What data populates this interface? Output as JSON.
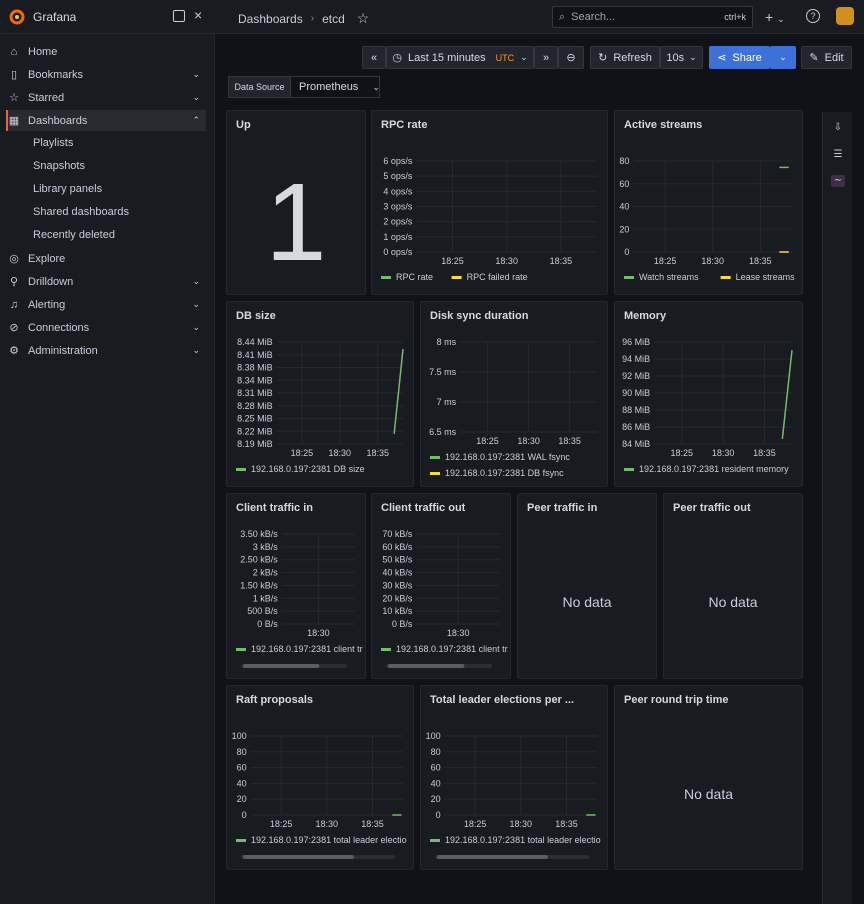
{
  "app": {
    "brand": "Grafana"
  },
  "breadcrumb": {
    "dashboards": "Dashboards",
    "current": "etcd"
  },
  "search": {
    "placeholder": "Search...",
    "shortcut": "ctrl+k"
  },
  "sidebar": {
    "items": [
      {
        "label": "Home",
        "icon": "home-icon"
      },
      {
        "label": "Bookmarks",
        "icon": "bookmark-icon"
      },
      {
        "label": "Starred",
        "icon": "star-icon"
      },
      {
        "label": "Dashboards",
        "icon": "dashboards-icon"
      },
      {
        "label": "Explore",
        "icon": "compass-icon"
      },
      {
        "label": "Drilldown",
        "icon": "drilldown-icon"
      },
      {
        "label": "Alerting",
        "icon": "bell-icon"
      },
      {
        "label": "Connections",
        "icon": "connections-icon"
      },
      {
        "label": "Administration",
        "icon": "gear-icon"
      }
    ],
    "subitems": [
      "Playlists",
      "Snapshots",
      "Library panels",
      "Shared dashboards",
      "Recently deleted"
    ]
  },
  "toolbar": {
    "time_range": "Last 15 minutes",
    "tz": "UTC",
    "refresh": "Refresh",
    "interval": "10s",
    "share": "Share",
    "edit": "Edit"
  },
  "variable": {
    "label": "Data Source",
    "value": "Prometheus"
  },
  "panels": {
    "up": {
      "title": "Up",
      "value": "1"
    },
    "rpc": {
      "title": "RPC rate"
    },
    "streams": {
      "title": "Active streams"
    },
    "db": {
      "title": "DB size"
    },
    "disk": {
      "title": "Disk sync duration"
    },
    "mem": {
      "title": "Memory"
    },
    "cin": {
      "title": "Client traffic in"
    },
    "cout": {
      "title": "Client traffic out"
    },
    "pin": {
      "title": "Peer traffic in",
      "nodata": "No data"
    },
    "pout": {
      "title": "Peer traffic out",
      "nodata": "No data"
    },
    "raft": {
      "title": "Raft proposals"
    },
    "elect": {
      "title": "Total leader elections per ..."
    },
    "rtt": {
      "title": "Peer round trip time",
      "nodata": "No data"
    }
  },
  "chart_data": [
    {
      "id": "rpc",
      "type": "line",
      "y_ticks": [
        "6 ops/s",
        "5 ops/s",
        "4 ops/s",
        "3 ops/s",
        "2 ops/s",
        "1 ops/s",
        "0 ops/s"
      ],
      "x_ticks": [
        "18:25",
        "18:30",
        "18:35"
      ],
      "legend": [
        {
          "name": "RPC rate",
          "color": "#73bf69"
        },
        {
          "name": "RPC failed rate",
          "color": "#fade2a"
        }
      ],
      "series": []
    },
    {
      "id": "streams",
      "type": "line",
      "y_ticks": [
        "80",
        "60",
        "40",
        "20",
        "0"
      ],
      "x_ticks": [
        "18:25",
        "18:30",
        "18:35"
      ],
      "legend": [
        {
          "name": "Watch streams",
          "color": "#73bf69"
        },
        {
          "name": "Lease streams",
          "color": "#fade2a"
        }
      ],
      "series": [
        {
          "name": "Watch streams",
          "color": "#73bf69",
          "segment": [
            0.92,
            0.98
          ],
          "yfrac": 0.93
        },
        {
          "name": "Lease streams",
          "color": "#fade2a",
          "segment": [
            0.92,
            0.98
          ],
          "yfrac": 0.0
        }
      ]
    },
    {
      "id": "db",
      "type": "line",
      "y_ticks": [
        "8.44 MiB",
        "8.41 MiB",
        "8.38 MiB",
        "8.34 MiB",
        "8.31 MiB",
        "8.28 MiB",
        "8.25 MiB",
        "8.22 MiB",
        "8.19 MiB"
      ],
      "x_ticks": [
        "18:25",
        "18:30",
        "18:35"
      ],
      "legend": [
        {
          "name": "192.168.0.197:2381 DB size",
          "color": "#73bf69"
        }
      ],
      "series": [
        {
          "color": "#73bf69",
          "line": [
            [
              0.93,
              0.1
            ],
            [
              1.0,
              0.93
            ]
          ]
        }
      ]
    },
    {
      "id": "disk",
      "type": "line",
      "y_ticks": [
        "8 ms",
        "7.5 ms",
        "7 ms",
        "6.5 ms"
      ],
      "x_ticks": [
        "18:25",
        "18:30",
        "18:35"
      ],
      "legend": [
        {
          "name": "192.168.0.197:2381 WAL fsync",
          "color": "#73bf69"
        },
        {
          "name": "192.168.0.197:2381 DB fsync",
          "color": "#fade2a"
        }
      ],
      "series": []
    },
    {
      "id": "mem",
      "type": "line",
      "y_ticks": [
        "96 MiB",
        "94 MiB",
        "92 MiB",
        "90 MiB",
        "88 MiB",
        "86 MiB",
        "84 MiB"
      ],
      "x_ticks": [
        "18:25",
        "18:30",
        "18:35"
      ],
      "legend": [
        {
          "name": "192.168.0.197:2381 resident memory",
          "color": "#73bf69"
        }
      ],
      "series": [
        {
          "color": "#73bf69",
          "line": [
            [
              0.93,
              0.05
            ],
            [
              1.0,
              0.92
            ]
          ]
        }
      ]
    },
    {
      "id": "cin",
      "type": "line",
      "y_ticks": [
        "3.50 kB/s",
        "3 kB/s",
        "2.50 kB/s",
        "2 kB/s",
        "1.50 kB/s",
        "1 kB/s",
        "500 B/s",
        "0 B/s"
      ],
      "x_ticks": [
        "18:30"
      ],
      "legend": [
        {
          "name": "192.168.0.197:2381 client tr",
          "color": "#73bf69"
        }
      ],
      "series": []
    },
    {
      "id": "cout",
      "type": "line",
      "y_ticks": [
        "70 kB/s",
        "60 kB/s",
        "50 kB/s",
        "40 kB/s",
        "30 kB/s",
        "20 kB/s",
        "10 kB/s",
        "0 B/s"
      ],
      "x_ticks": [
        "18:30"
      ],
      "legend": [
        {
          "name": "192.168.0.197:2381 client tr",
          "color": "#73bf69"
        }
      ],
      "series": []
    },
    {
      "id": "raft",
      "type": "line",
      "y_ticks": [
        "100",
        "80",
        "60",
        "40",
        "20",
        "0"
      ],
      "x_ticks": [
        "18:25",
        "18:30",
        "18:35"
      ],
      "legend": [
        {
          "name": "192.168.0.197:2381 total leader electio",
          "color": "#73bf69"
        }
      ],
      "series": [
        {
          "color": "#73bf69",
          "segment": [
            0.93,
            0.99
          ],
          "yfrac": 0.0
        }
      ]
    },
    {
      "id": "elect",
      "type": "line",
      "y_ticks": [
        "100",
        "80",
        "60",
        "40",
        "20",
        "0"
      ],
      "x_ticks": [
        "18:25",
        "18:30",
        "18:35"
      ],
      "legend": [
        {
          "name": "192.168.0.197:2381 total leader electio",
          "color": "#73bf69"
        }
      ],
      "series": [
        {
          "color": "#73bf69",
          "segment": [
            0.93,
            0.99
          ],
          "yfrac": 0.0
        }
      ]
    }
  ]
}
